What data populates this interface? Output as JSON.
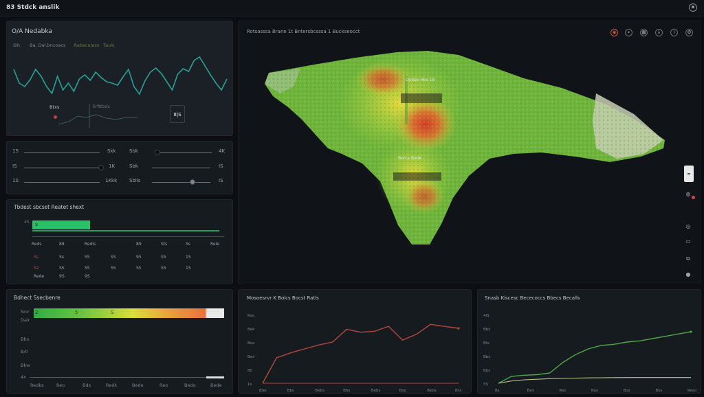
{
  "app": {
    "title": "83  Stdck anslik"
  },
  "header_panel": {
    "title": "O/A Nedabka",
    "subtitle_items": [
      "Sih",
      "Ba.  Dal.bncoacs",
      "Rabecnlass",
      "Tauls"
    ],
    "legend_item": "Btxs",
    "mini_label": "Erfttbsls",
    "value_box": "8|S"
  },
  "sliders": {
    "left": [
      {
        "label": "1S",
        "value": "Skk"
      },
      {
        "label": "IS",
        "value": "1K"
      },
      {
        "label": "1S",
        "value": "1Kkk"
      }
    ],
    "right": [
      {
        "label": "Sbk",
        "value": "4K"
      },
      {
        "label": "Sbk",
        "value": "IS"
      },
      {
        "label": "Sblls",
        "value": "IS"
      }
    ]
  },
  "table_panel": {
    "title": "Tbdest sbcset  Reatet shext",
    "bar_label": "4S",
    "bar_value": "S",
    "header": [
      "Reds",
      "88",
      "Redls",
      "89",
      "Sts",
      "Ss",
      "Rele"
    ],
    "rows": [
      [
        "Ss",
        "Ss",
        "S5",
        "SS",
        "95",
        "S5",
        "1S"
      ],
      [
        "S2",
        "SS",
        "S5",
        "S5",
        "S5",
        "S5",
        "1S"
      ]
    ],
    "row_labels": [
      "Rede",
      "9S",
      "9S"
    ]
  },
  "gradient_panel": {
    "title": "Bdhect Ssecbenre",
    "y_labels": [
      "Sinr",
      "Dair",
      "Bkn",
      "B/0",
      "Bkw",
      "4x"
    ],
    "ramp_labels": [
      "2",
      "5",
      "S"
    ],
    "x_labels": [
      "Redks",
      "Reo",
      "Bds",
      "Redk",
      "Bede",
      "Reo",
      "Bedo",
      "Bede"
    ],
    "colors": {
      "green": "#2fae45",
      "yellow": "#d9de3c",
      "orange": "#e9713c",
      "white": "#e8e8e8"
    }
  },
  "map_panel": {
    "title": "Rotsasssa  Brane 1t Bntersbcsssa  1 Buckseocct",
    "toolbar_icons": [
      "layers-icon",
      "location-icon",
      "grid-icon",
      "download-icon",
      "info-icon",
      "settings-icon"
    ],
    "labels": [
      "Dedee Hbs 18",
      "Borce Bede"
    ],
    "side_icons": [
      "zoom-icon",
      "globe-icon",
      "compass-icon",
      "ruler-icon",
      "layers-stack-icon",
      "reset-icon"
    ]
  },
  "chart2_panel": {
    "title": "Mosoesrvr  K Bolcs  Bocst  Ratls"
  },
  "chart3_panel": {
    "title": "Snasb  Kiscesc  Bececoccs  Bbecs Becalls"
  },
  "chart_data": [
    {
      "type": "line",
      "panel": "header",
      "series": [
        {
          "values": [
            4,
            2,
            1.5,
            2.5,
            4,
            3,
            1.5,
            0.5,
            3,
            1,
            2,
            0.8,
            2.6,
            3.2,
            2.4,
            3.6,
            2.8,
            2.2,
            2,
            1.7,
            2.9,
            4,
            1.5,
            0.4,
            2.3,
            3.6,
            4.2,
            3.4,
            2.2,
            1,
            3.3,
            4.1,
            3.7,
            5.3,
            5.8,
            4.5,
            3.2,
            2,
            1,
            2.6
          ]
        }
      ],
      "color": "#27a296"
    },
    {
      "type": "line",
      "panel": "chart2",
      "y_labels": [
        "Ras",
        "Bek",
        "Bos",
        "Bes",
        "80",
        "1s"
      ],
      "x_labels": [
        "BSe",
        "Bbs",
        "Bebs",
        "Bbs",
        "Bebs",
        "Bos",
        "Bebs",
        "Bss"
      ],
      "series": [
        {
          "values": [
            0,
            26,
            31,
            35,
            39,
            42,
            55,
            52,
            53,
            58,
            44,
            50,
            60,
            58,
            56
          ],
          "color": "#b5473c"
        },
        {
          "values": [
            0,
            0,
            0,
            0,
            0,
            0,
            0,
            0,
            0,
            0,
            0,
            0,
            0,
            0,
            0
          ],
          "color": "#b5473c"
        }
      ],
      "ylim": [
        0,
        70
      ]
    },
    {
      "type": "line",
      "panel": "chart3",
      "y_labels": [
        "4lS",
        "Bbs",
        "Bts",
        "Bbs",
        "Bbs",
        "5S"
      ],
      "x_labels": [
        "Bs",
        "Bes",
        "Res",
        "Bos",
        "Bos",
        "Bos",
        "Reso"
      ],
      "series": [
        {
          "values": [
            0,
            6,
            7,
            7.5,
            9,
            18,
            25,
            30,
            33,
            34,
            36,
            37,
            39,
            41,
            43,
            45
          ],
          "color": "#4ea845"
        },
        {
          "values": [
            0,
            2,
            3,
            3.5,
            4,
            4.2,
            4.5,
            4.7,
            4.8,
            4.9,
            5,
            5,
            5,
            5,
            5,
            5
          ],
          "color": "#bfc28a"
        }
      ],
      "ylim": [
        0,
        60
      ]
    }
  ]
}
